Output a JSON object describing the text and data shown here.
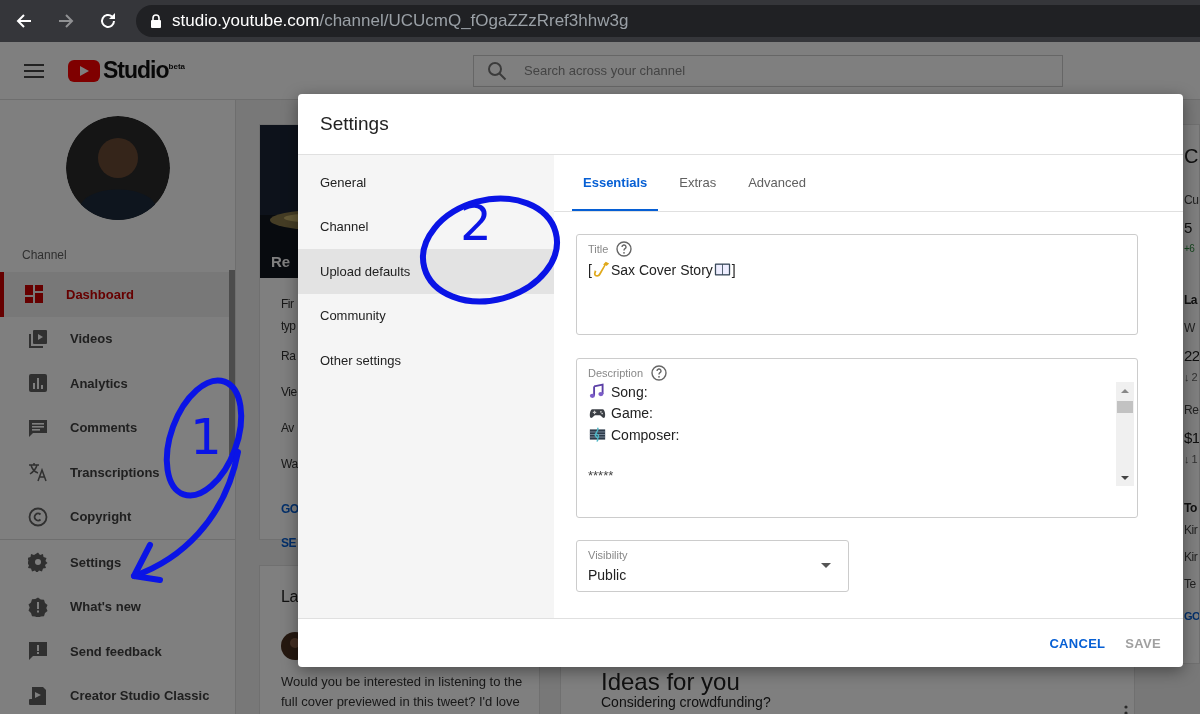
{
  "browser": {
    "url_host": "studio.youtube.com",
    "url_path": "/channel/UCUcmQ_fOgaZZzRref3hhw3g",
    "forward_disabled": true
  },
  "header": {
    "logo": "Studio$^{beta}$",
    "search_placeholder": "Search across your channel"
  },
  "sidebar": {
    "section": "Channel",
    "items": [
      {
        "label": "Dashboard",
        "selected": true
      },
      {
        "label": "Videos",
        "selected": false
      },
      {
        "label": "Analytics",
        "selected": false
      },
      {
        "label": "Comments",
        "selected": false
      },
      {
        "label": "Transcriptions",
        "selected": false
      },
      {
        "label": "Copyright",
        "selected": false
      }
    ],
    "footer_items": [
      {
        "label": "Settings",
        "selected": false
      },
      {
        "label": "What's new",
        "selected": false
      },
      {
        "label": "Send feedback",
        "selected": false
      },
      {
        "label": "Creator Studio Classic",
        "selected": false
      }
    ]
  },
  "background": {
    "overview_card": {
      "banner": "Re",
      "lines": [
        "Fir",
        "typ",
        "Ra",
        "Vie",
        "Av",
        "Wa"
      ],
      "links": [
        "GO",
        "SE"
      ]
    },
    "post_card": {
      "title": "La",
      "lines": [
        "Would you be interested in listening to the",
        "full cover previewed in this tweet? I'd love"
      ]
    },
    "ideas_card": {
      "title": "Ideas for you",
      "item": "Considering crowdfunding?"
    },
    "analytics_card": [
      {
        "kind": "heading",
        "text": "C"
      },
      {
        "kind": "label",
        "text": "Cu"
      },
      {
        "kind": "big",
        "text": "5"
      },
      {
        "kind": "up",
        "text": "+6"
      },
      {
        "kind": "section",
        "text": "La"
      },
      {
        "kind": "label",
        "text": "W"
      },
      {
        "kind": "big",
        "text": "22"
      },
      {
        "kind": "down",
        "text": "↓ 2"
      },
      {
        "kind": "label",
        "text": "Re"
      },
      {
        "kind": "big",
        "text": "$1"
      },
      {
        "kind": "down",
        "text": "↓ 1"
      },
      {
        "kind": "section",
        "text": "To"
      },
      {
        "kind": "row",
        "text": "Kir"
      },
      {
        "kind": "row",
        "text": "Kir"
      },
      {
        "kind": "row",
        "text": "Te"
      },
      {
        "kind": "link",
        "text": "GO"
      }
    ]
  },
  "dialog": {
    "title": "Settings",
    "nav": [
      {
        "label": "General",
        "selected": false
      },
      {
        "label": "Channel",
        "selected": false
      },
      {
        "label": "Upload defaults",
        "selected": true
      },
      {
        "label": "Community",
        "selected": false
      },
      {
        "label": "Other settings",
        "selected": false
      }
    ],
    "tabs": [
      {
        "label": "Essentials",
        "selected": true
      },
      {
        "label": "Extras",
        "selected": false
      },
      {
        "label": "Advanced",
        "selected": false
      }
    ],
    "title_field": {
      "label": "Title",
      "before": "[",
      "text": "Sax Cover Story",
      "after": "]"
    },
    "description_field": {
      "label": "Description",
      "lines": [
        "Song:",
        "Game:",
        "Composer:"
      ],
      "note": "*****"
    },
    "visibility": {
      "label": "Visibility",
      "value": "Public"
    },
    "buttons": [
      {
        "label": "CANCEL",
        "disabled": false
      },
      {
        "label": "SAVE",
        "disabled": true
      }
    ]
  },
  "annotations": [
    {
      "label": "1"
    },
    {
      "label": "2"
    }
  ]
}
